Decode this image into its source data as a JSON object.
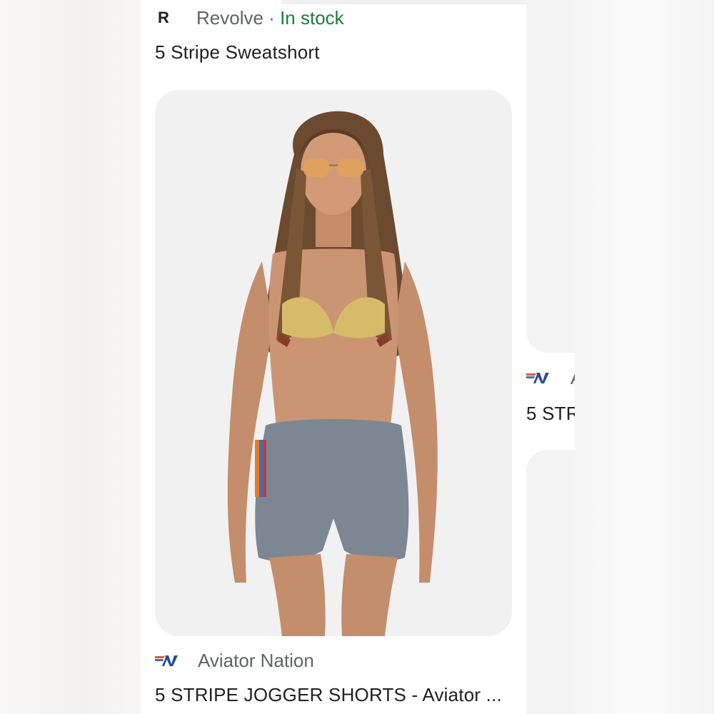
{
  "result_1": {
    "source_name": "Revolve",
    "separator": "·",
    "availability": "In stock",
    "title": "5 Stripe Sweatshort",
    "colors": {
      "availability": "#188038",
      "source": "#5f6368",
      "title": "#202124"
    }
  },
  "product_image": {
    "icon": "product-photo"
  },
  "result_2": {
    "source_name": "Aviator Nation",
    "title": "5 STRIPE JOGGER SHORTS - Aviator ..."
  },
  "peek_result": {
    "source_name_partial": "A",
    "title_partial": "5 STR"
  },
  "icons": {
    "revolve": "revolve-r-logo",
    "aviator": "aviator-nation-av-logo"
  },
  "logo_text": {
    "revolve": "R"
  }
}
